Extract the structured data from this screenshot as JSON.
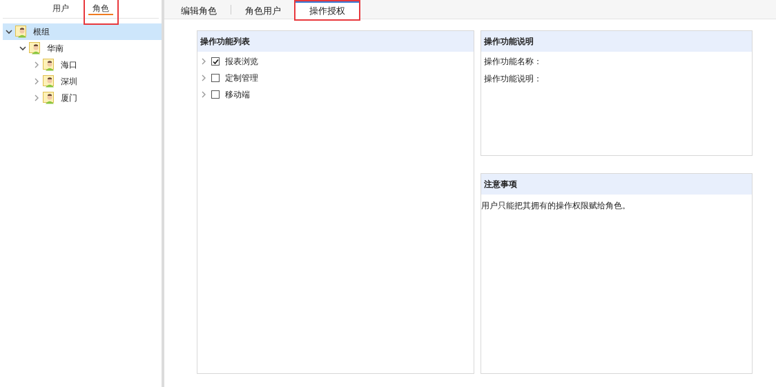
{
  "sidebar": {
    "tabs": [
      {
        "label": "用户",
        "selected": false,
        "highlighted": false
      },
      {
        "label": "角色",
        "selected": true,
        "highlighted": true
      }
    ],
    "tree": [
      {
        "label": "根组",
        "expanded": true,
        "selected": true,
        "children": [
          {
            "label": "华南",
            "expanded": true,
            "selected": false,
            "children": [
              {
                "label": "海口",
                "expanded": false,
                "selected": false
              },
              {
                "label": "深圳",
                "expanded": false,
                "selected": false
              },
              {
                "label": "厦门",
                "expanded": false,
                "selected": false
              }
            ]
          }
        ]
      }
    ]
  },
  "tabs": [
    {
      "label": "编辑角色",
      "selected": false,
      "highlighted": false
    },
    {
      "label": "角色用户",
      "selected": false,
      "highlighted": false
    },
    {
      "label": "操作授权",
      "selected": true,
      "highlighted": true
    }
  ],
  "function_list": {
    "title": "操作功能列表",
    "items": [
      {
        "label": "报表浏览",
        "checked": true,
        "expanded": false
      },
      {
        "label": "定制管理",
        "checked": false,
        "expanded": false
      },
      {
        "label": "移动端",
        "checked": false,
        "expanded": false
      }
    ]
  },
  "function_info": {
    "title": "操作功能说明",
    "fields": [
      "操作功能名称：",
      "操作功能说明："
    ]
  },
  "notes": {
    "title": "注意事项",
    "text": "用户只能把其拥有的操作权限赋给角色。"
  }
}
